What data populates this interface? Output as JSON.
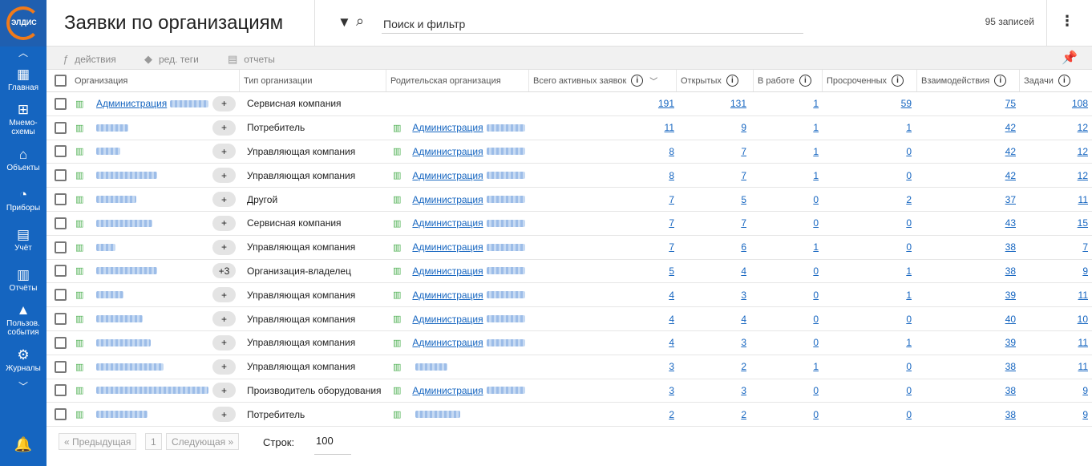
{
  "sidebar": {
    "logo_text": "ЭЛДИС",
    "items": [
      {
        "label": "Главная",
        "icon": "home-grid-icon"
      },
      {
        "label": "Мнемо-\nсхемы",
        "icon": "sitemap-icon"
      },
      {
        "label": "Объекты",
        "icon": "house-icon"
      },
      {
        "label": "Приборы",
        "icon": "gauge-icon"
      },
      {
        "label": "Учёт",
        "icon": "calculator-icon"
      },
      {
        "label": "Отчёты",
        "icon": "document-icon"
      },
      {
        "label": "Пользов.\nсобытия",
        "icon": "warning-icon"
      },
      {
        "label": "Журналы",
        "icon": "users-gear-icon"
      }
    ]
  },
  "header": {
    "title": "Заявки по организациям",
    "search_placeholder": "Поиск и фильтр",
    "records": "95 записей"
  },
  "toolbar": {
    "actions_label": "действия",
    "tags_label": "ред. теги",
    "reports_label": "отчеты"
  },
  "table": {
    "columns": {
      "org": "Организация",
      "type": "Тип организации",
      "parent": "Родительская организация",
      "total": "Всего активных заявок",
      "open": "Открытых",
      "work": "В работе",
      "overdue": "Просроченных",
      "inter": "Взаимодействия",
      "tasks": "Задачи"
    },
    "rows": [
      {
        "org": "Администрация",
        "tag": "+",
        "type": "Сервисная компания",
        "parent": "",
        "total": "191",
        "open": "131",
        "work": "1",
        "overdue": "59",
        "inter": "75",
        "tasks": "108"
      },
      {
        "org": "",
        "tag": "+",
        "type": "Потребитель",
        "parent": "Администрация",
        "total": "11",
        "open": "9",
        "work": "1",
        "overdue": "1",
        "inter": "42",
        "tasks": "12"
      },
      {
        "org": "",
        "tag": "+",
        "type": "Управляющая компания",
        "parent": "Администрация",
        "total": "8",
        "open": "7",
        "work": "1",
        "overdue": "0",
        "inter": "42",
        "tasks": "12"
      },
      {
        "org": "",
        "tag": "+",
        "type": "Управляющая компания",
        "parent": "Администрация",
        "total": "8",
        "open": "7",
        "work": "1",
        "overdue": "0",
        "inter": "42",
        "tasks": "12"
      },
      {
        "org": "",
        "tag": "+",
        "type": "Другой",
        "parent": "Администрация",
        "total": "7",
        "open": "5",
        "work": "0",
        "overdue": "2",
        "inter": "37",
        "tasks": "11"
      },
      {
        "org": "",
        "tag": "+",
        "type": "Сервисная компания",
        "parent": "Администрация",
        "total": "7",
        "open": "7",
        "work": "0",
        "overdue": "0",
        "inter": "43",
        "tasks": "15"
      },
      {
        "org": "",
        "tag": "+",
        "type": "Управляющая компания",
        "parent": "Администрация",
        "total": "7",
        "open": "6",
        "work": "1",
        "overdue": "0",
        "inter": "38",
        "tasks": "7"
      },
      {
        "org": "",
        "tag": "+3",
        "type": "Организация-владелец",
        "parent": "Администрация",
        "total": "5",
        "open": "4",
        "work": "0",
        "overdue": "1",
        "inter": "38",
        "tasks": "9"
      },
      {
        "org": "",
        "tag": "+",
        "type": "Управляющая компания",
        "parent": "Администрация",
        "total": "4",
        "open": "3",
        "work": "0",
        "overdue": "1",
        "inter": "39",
        "tasks": "11"
      },
      {
        "org": "",
        "tag": "+",
        "type": "Управляющая компания",
        "parent": "Администрация",
        "total": "4",
        "open": "4",
        "work": "0",
        "overdue": "0",
        "inter": "40",
        "tasks": "10"
      },
      {
        "org": "",
        "tag": "+",
        "type": "Управляющая компания",
        "parent": "Администрация",
        "total": "4",
        "open": "3",
        "work": "0",
        "overdue": "1",
        "inter": "39",
        "tasks": "11"
      },
      {
        "org": "",
        "tag": "+",
        "type": "Управляющая компания",
        "parent": "",
        "total": "3",
        "open": "2",
        "work": "1",
        "overdue": "0",
        "inter": "38",
        "tasks": "11"
      },
      {
        "org": "",
        "tag": "+",
        "type": "Производитель оборудования",
        "parent": "Администрация",
        "total": "3",
        "open": "3",
        "work": "0",
        "overdue": "0",
        "inter": "38",
        "tasks": "9"
      },
      {
        "org": "",
        "tag": "+",
        "type": "Потребитель",
        "parent": "",
        "total": "2",
        "open": "2",
        "work": "0",
        "overdue": "0",
        "inter": "38",
        "tasks": "9"
      }
    ]
  },
  "pagination": {
    "prev": "« Предыдущая",
    "page": "1",
    "next": "Следующая »",
    "rows_label": "Строк:",
    "rows_value": "100"
  },
  "colors": {
    "sidebar": "#1565c0",
    "link": "#1565c0",
    "building": "#4caf50"
  }
}
